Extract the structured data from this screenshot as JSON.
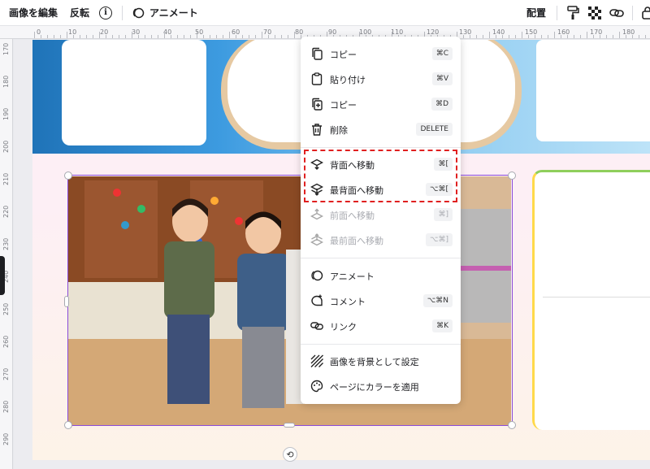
{
  "toolbar": {
    "edit_image": "画像を編集",
    "flip": "反転",
    "info": "i",
    "animate": "アニメート",
    "position": "配置"
  },
  "ruler": {
    "top_ticks": [
      "0",
      "10",
      "20",
      "30",
      "40",
      "50",
      "60",
      "70",
      "80",
      "90",
      "100",
      "110",
      "120",
      "130",
      "140",
      "150",
      "160",
      "170",
      "180"
    ],
    "left_ticks": [
      "170",
      "180",
      "190",
      "200",
      "210",
      "220",
      "230",
      "240",
      "250",
      "260",
      "270",
      "280",
      "290"
    ]
  },
  "menu": {
    "items": [
      {
        "label": "コピー",
        "shortcut": "⌘C",
        "icon": "copy-icon",
        "enabled": true
      },
      {
        "label": "貼り付け",
        "shortcut": "⌘V",
        "icon": "paste-icon",
        "enabled": true
      },
      {
        "label": "コピー",
        "shortcut": "⌘D",
        "icon": "duplicate-icon",
        "enabled": true
      },
      {
        "label": "削除",
        "shortcut": "DELETE",
        "icon": "trash-icon",
        "enabled": true
      },
      {
        "label": "背面へ移動",
        "shortcut": "⌘[",
        "icon": "send-backward-icon",
        "enabled": true
      },
      {
        "label": "最背面へ移動",
        "shortcut": "⌥⌘[",
        "icon": "send-to-back-icon",
        "enabled": true
      },
      {
        "label": "前面へ移動",
        "shortcut": "⌘]",
        "icon": "bring-forward-icon",
        "enabled": false
      },
      {
        "label": "最前面へ移動",
        "shortcut": "⌥⌘]",
        "icon": "bring-to-front-icon",
        "enabled": false
      },
      {
        "label": "アニメート",
        "shortcut": "",
        "icon": "animate-icon",
        "enabled": true
      },
      {
        "label": "コメント",
        "shortcut": "⌥⌘N",
        "icon": "comment-icon",
        "enabled": true
      },
      {
        "label": "リンク",
        "shortcut": "⌘K",
        "icon": "link-icon",
        "enabled": true
      },
      {
        "label": "画像を背景として設定",
        "shortcut": "",
        "icon": "background-icon",
        "enabled": true
      },
      {
        "label": "ページにカラーを適用",
        "shortcut": "",
        "icon": "palette-icon",
        "enabled": true
      }
    ]
  },
  "colors": {
    "selection": "#8a4bd8",
    "highlight": "#e02020"
  }
}
